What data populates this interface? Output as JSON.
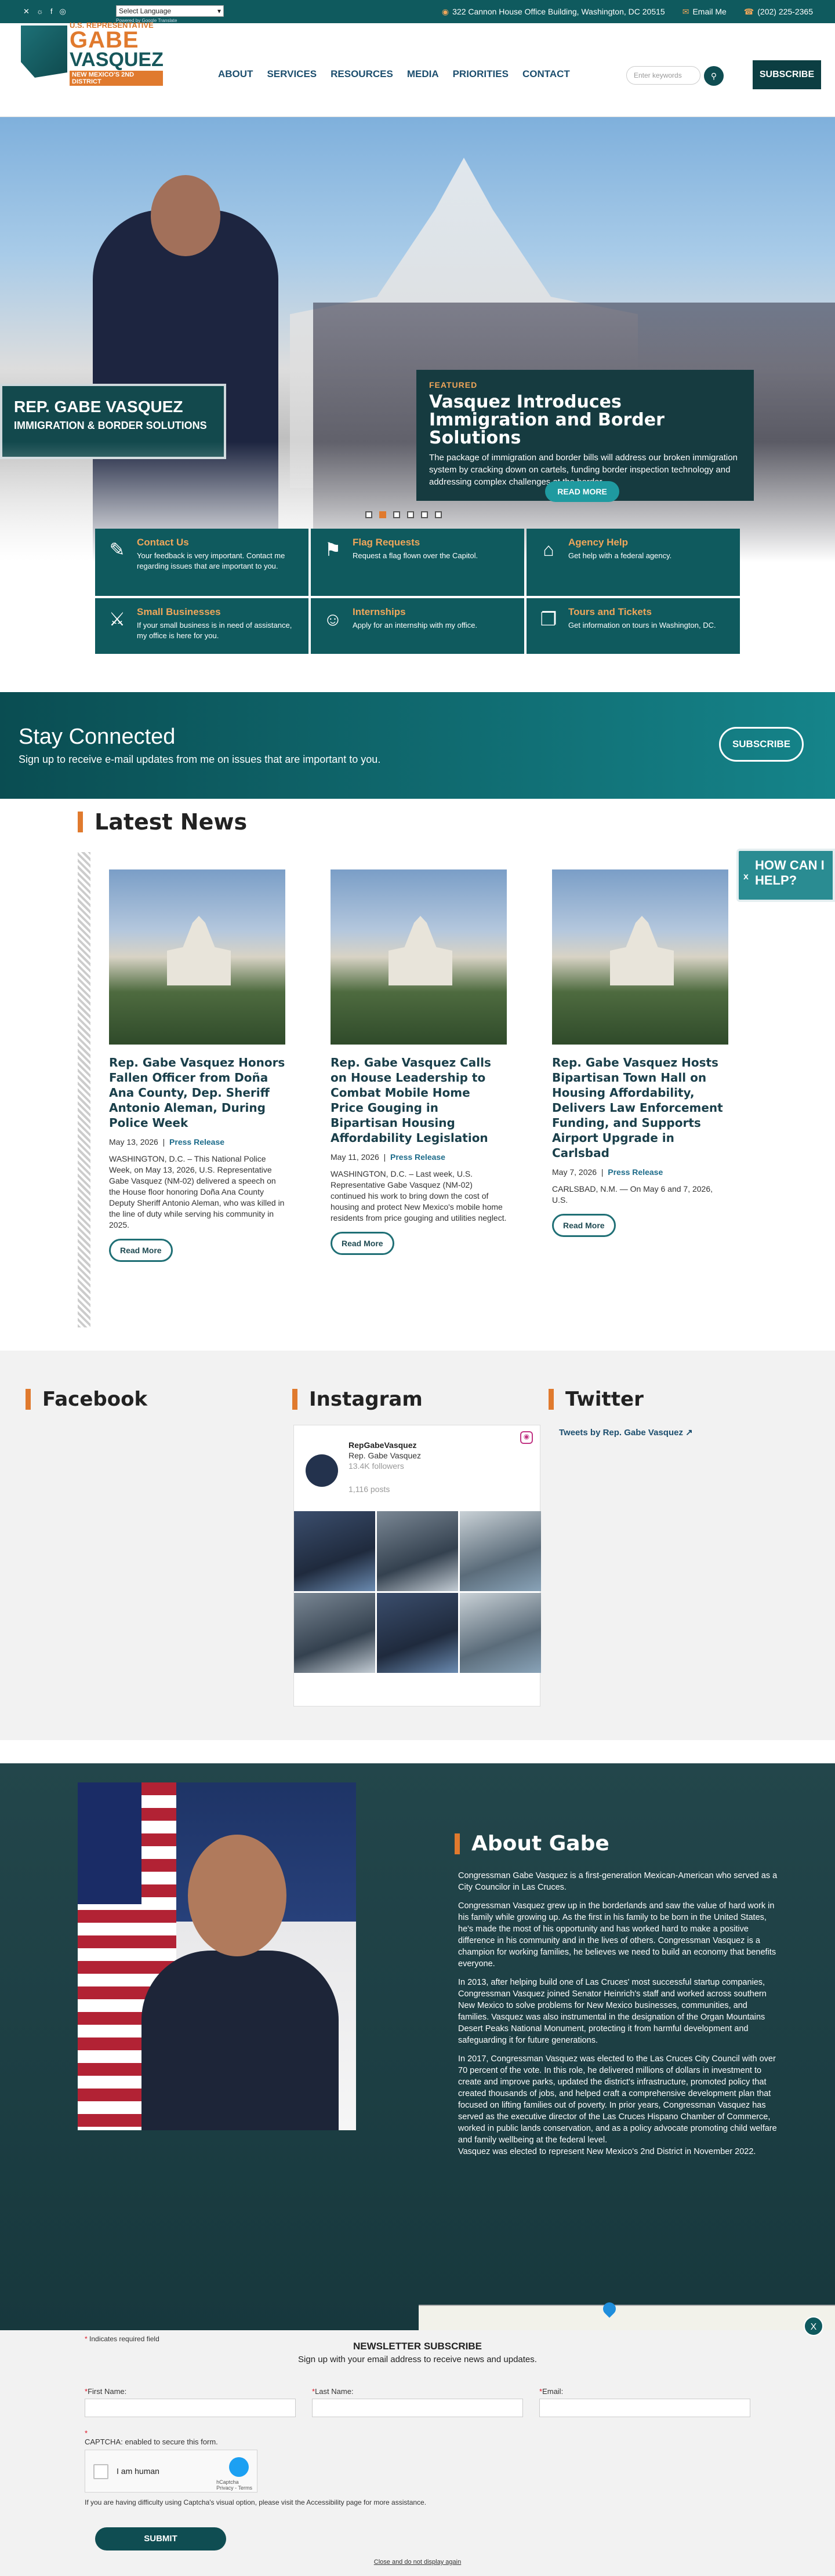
{
  "topbar": {
    "social": [
      "✕",
      "𝄞",
      "f",
      "◎"
    ],
    "language": "Select Language",
    "powered": "Powered by Google Translate",
    "address": "322 Cannon House Office Building, Washington, DC 20515",
    "email": "Email Me",
    "phone": "(202) 225-2365"
  },
  "logo": {
    "small": "U.S. REPRESENTATIVE",
    "first": "GABE",
    "last": "VASQUEZ",
    "district": "NEW MEXICO'S 2ND DISTRICT"
  },
  "nav": [
    "ABOUT",
    "SERVICES",
    "RESOURCES",
    "MEDIA",
    "PRIORITIES",
    "CONTACT"
  ],
  "search": {
    "placeholder": "Enter keywords"
  },
  "header": {
    "subscribe": "SUBSCRIBE"
  },
  "hero": {
    "sign_line1": "REP. GABE VASQUEZ",
    "sign_line2": "IMMIGRATION & BORDER SOLUTIONS",
    "featured_tag": "FEATURED",
    "featured_title": "Vasquez Introduces Immigration and Border Solutions",
    "featured_desc": "The package of immigration and border bills will address our broken immigration system by cracking down on cartels, funding border inspection technology and addressing complex challenges at the border.",
    "read_more": "READ MORE",
    "slides": 6,
    "active_slide": 2
  },
  "quick_links": [
    {
      "icon": "edit-icon",
      "glyph": "✎",
      "title": "Contact Us",
      "desc": "Your feedback is very important. Contact me regarding issues that are important to you."
    },
    {
      "icon": "flag-icon",
      "glyph": "⚑",
      "title": "Flag Requests",
      "desc": "Request a flag flown over the Capitol."
    },
    {
      "icon": "building-icon",
      "glyph": "⌂",
      "title": "Agency Help",
      "desc": "Get help with a federal agency."
    },
    {
      "icon": "handshake-icon",
      "glyph": "⚔",
      "title": "Small Businesses",
      "desc": "If your small business is in need of assistance, my office is here for you."
    },
    {
      "icon": "person-icon",
      "glyph": "☺",
      "title": "Internships",
      "desc": "Apply for an internship with my office."
    },
    {
      "icon": "ticket-icon",
      "glyph": "❐",
      "title": "Tours and Tickets",
      "desc": "Get information on tours in Washington, DC."
    }
  ],
  "stay": {
    "heading": "Stay Connected",
    "sub": "Sign up to receive e-mail updates from me on issues that are important to you.",
    "button": "SUBSCRIBE"
  },
  "latest_news": {
    "heading": "Latest News",
    "items": [
      {
        "title": "Rep. Gabe Vasquez Honors Fallen Officer from Doña Ana County, Dep. Sheriff Antonio Aleman, During Police Week",
        "date": "May 13, 2026",
        "type": "Press Release",
        "body": "WASHINGTON, D.C. – This National Police Week, on May 13, 2026, U.S. Representative Gabe Vasquez (NM-02) delivered a speech on the House floor honoring Doña Ana County Deputy Sheriff Antonio Aleman, who was killed in the line of duty while serving his community in 2025.",
        "more": "Read More"
      },
      {
        "title": "Rep. Gabe Vasquez Calls on House Leadership to Combat Mobile Home Price Gouging in Bipartisan Housing Affordability Legislation",
        "date": "May 11, 2026",
        "type": "Press Release",
        "body": "WASHINGTON, D.C. – Last week, U.S. Representative Gabe Vasquez (NM-02) continued his work to bring down the cost of housing and protect New Mexico's mobile home residents from price gouging and utilities neglect.",
        "more": "Read More"
      },
      {
        "title": "Rep. Gabe Vasquez Hosts Bipartisan Town Hall on Housing Affordability, Delivers Law Enforcement Funding, and Supports Airport Upgrade in Carlsbad",
        "date": "May 7, 2026",
        "type": "Press Release",
        "body": "CARLSBAD, N.M. — On May 6 and 7, 2026, U.S.",
        "more": "Read More"
      }
    ]
  },
  "help_tab": {
    "close": "x",
    "label": "HOW CAN I HELP?"
  },
  "social": {
    "facebook": "Facebook",
    "instagram": "Instagram",
    "twitter": "Twitter",
    "ig_handle": "RepGabeVasquez",
    "ig_name": "Rep. Gabe Vasquez",
    "ig_followers": "13.4K followers",
    "ig_posts": "1,116 posts",
    "tw_link": "Tweets by Rep. Gabe Vasquez"
  },
  "about": {
    "heading": "About Gabe",
    "paras": [
      "Congressman Gabe Vasquez is a first-generation Mexican-American who served as a City Councilor in Las Cruces.",
      "Congressman Vasquez grew up in the borderlands and saw the value of hard work in his family while growing up. As the first in his family to be born in the United States, he's made the most of his opportunity and has worked hard to make a positive difference in his community and in the lives of others. Congressman Vasquez is a champion for working families, he believes we need to build an economy that benefits everyone.",
      "In 2013, after helping build one of Las Cruces' most successful startup companies, Congressman Vasquez joined Senator Heinrich's staff and worked across southern New Mexico to solve problems for New Mexico businesses, communities, and families. Vasquez was also instrumental in the designation of the Organ Mountains Desert Peaks National Monument, protecting it from harmful development and safeguarding it for future generations.",
      "In 2017, Congressman Vasquez was elected to the Las Cruces City Council with over 70 percent of the vote. In this role, he delivered millions of dollars in investment to create and improve parks, updated the district's infrastructure, promoted policy that created thousands of jobs, and helped craft a comprehensive development plan that focused on lifting families out of poverty. In prior years, Congressman Vasquez has served as the executive director of the Las Cruces Hispano Chamber of Commerce, worked in public lands conservation, and as a policy advocate promoting child welfare and family wellbeing at the federal level.\nVasquez was elected to represent New Mexico's 2nd District in November 2022."
    ]
  },
  "newsletter": {
    "required": "Indicates required field",
    "heading": "NEWSLETTER SUBSCRIBE",
    "sub": "Sign up with your email address to receive news and updates.",
    "first": "First Name:",
    "last": "Last Name:",
    "email": "Email:",
    "captcha_label": "CAPTCHA: enabled to secure this form.",
    "captcha_text": "I am human",
    "captcha_brand": "hCaptcha",
    "captcha_links": "Privacy - Terms",
    "difficulty": "If you are having difficulty using Captcha's visual option, please visit the Accessibility page for more assistance.",
    "submit": "SUBMIT",
    "close_link": "Close and do not display again",
    "close": "X"
  }
}
